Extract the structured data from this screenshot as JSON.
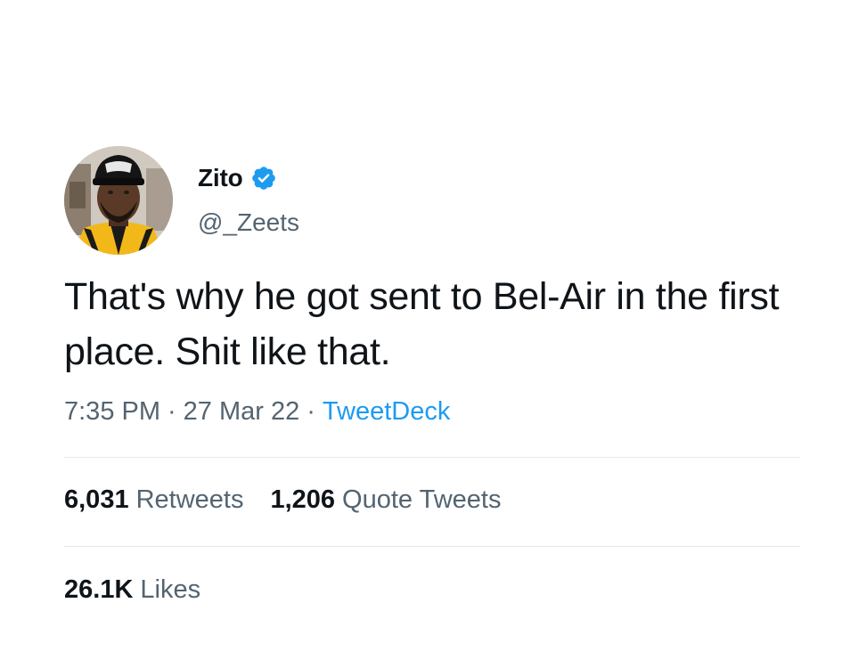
{
  "user": {
    "display_name": "Zito",
    "handle": "@_Zeets",
    "verified": true
  },
  "tweet": {
    "text": "That's why he got sent to Bel-Air in the first place. Shit like that.",
    "time": "7:35 PM",
    "date": "27 Mar 22",
    "source": "TweetDeck",
    "separator": "·"
  },
  "stats": {
    "retweets": {
      "count": "6,031",
      "label": "Retweets"
    },
    "quote_tweets": {
      "count": "1,206",
      "label": "Quote Tweets"
    },
    "likes": {
      "count": "26.1K",
      "label": "Likes"
    }
  },
  "icons": {
    "verified": "verified-badge-icon"
  },
  "colors": {
    "link": "#1d9bf0",
    "secondary_text": "#536471",
    "primary_text": "#0f1419",
    "divider": "#e6e9eb"
  }
}
